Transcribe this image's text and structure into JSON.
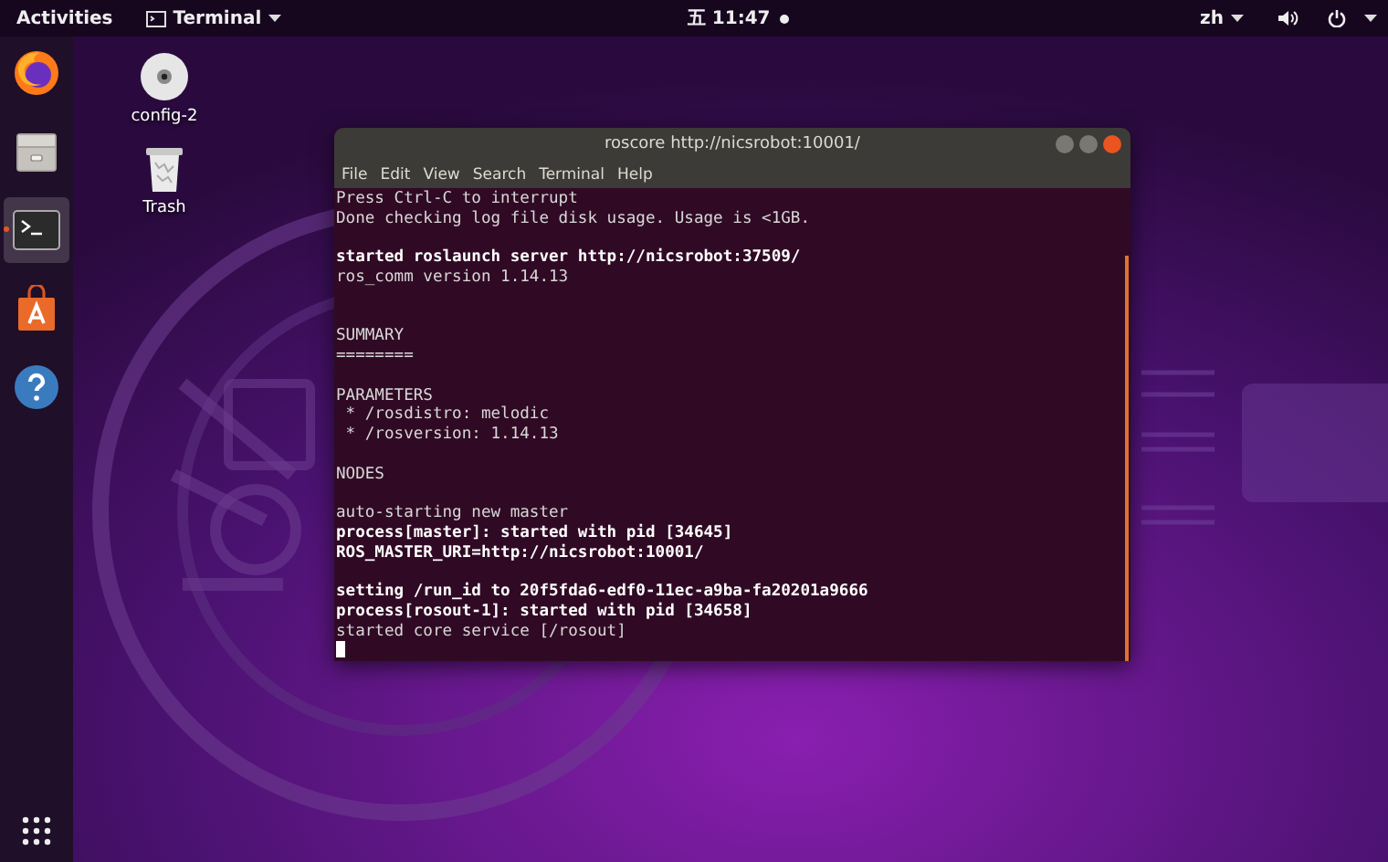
{
  "top_bar": {
    "activities": "Activities",
    "app_menu": "Terminal",
    "clock": "五 11:47",
    "input_method": "zh"
  },
  "dock": {
    "items": [
      {
        "kind": "firefox",
        "selected": false
      },
      {
        "kind": "files",
        "selected": false
      },
      {
        "kind": "terminal",
        "selected": true
      },
      {
        "kind": "software",
        "selected": false
      },
      {
        "kind": "help",
        "selected": false
      }
    ]
  },
  "desktop_icons": [
    {
      "kind": "disc",
      "label": "config-2"
    },
    {
      "kind": "trash",
      "label": "Trash"
    }
  ],
  "terminal": {
    "title": "roscore http://nicsrobot:10001/",
    "menu": [
      "File",
      "Edit",
      "View",
      "Search",
      "Terminal",
      "Help"
    ],
    "lines": [
      {
        "kind": "normal",
        "text": "Press Ctrl-C to interrupt"
      },
      {
        "kind": "normal",
        "text": "Done checking log file disk usage. Usage is <1GB."
      },
      {
        "kind": "blank"
      },
      {
        "kind": "bold",
        "text": "started roslaunch server http://nicsrobot:37509/"
      },
      {
        "kind": "normal",
        "text": "ros_comm version 1.14.13"
      },
      {
        "kind": "blank"
      },
      {
        "kind": "blank"
      },
      {
        "kind": "normal",
        "text": "SUMMARY"
      },
      {
        "kind": "normal",
        "text": "========"
      },
      {
        "kind": "blank"
      },
      {
        "kind": "normal",
        "text": "PARAMETERS"
      },
      {
        "kind": "normal",
        "text": " * /rosdistro: melodic"
      },
      {
        "kind": "normal",
        "text": " * /rosversion: 1.14.13"
      },
      {
        "kind": "blank"
      },
      {
        "kind": "normal",
        "text": "NODES"
      },
      {
        "kind": "blank"
      },
      {
        "kind": "normal",
        "text": "auto-starting new master"
      },
      {
        "kind": "bold",
        "text": "process[master]: started with pid [34645]"
      },
      {
        "kind": "bold",
        "text": "ROS_MASTER_URI=http://nicsrobot:10001/"
      },
      {
        "kind": "blank"
      },
      {
        "kind": "bold",
        "text": "setting /run_id to 20f5fda6-edf0-11ec-a9ba-fa20201a9666"
      },
      {
        "kind": "bold",
        "text": "process[rosout-1]: started with pid [34658]"
      },
      {
        "kind": "normal",
        "text": "started core service [/rosout]"
      }
    ]
  }
}
